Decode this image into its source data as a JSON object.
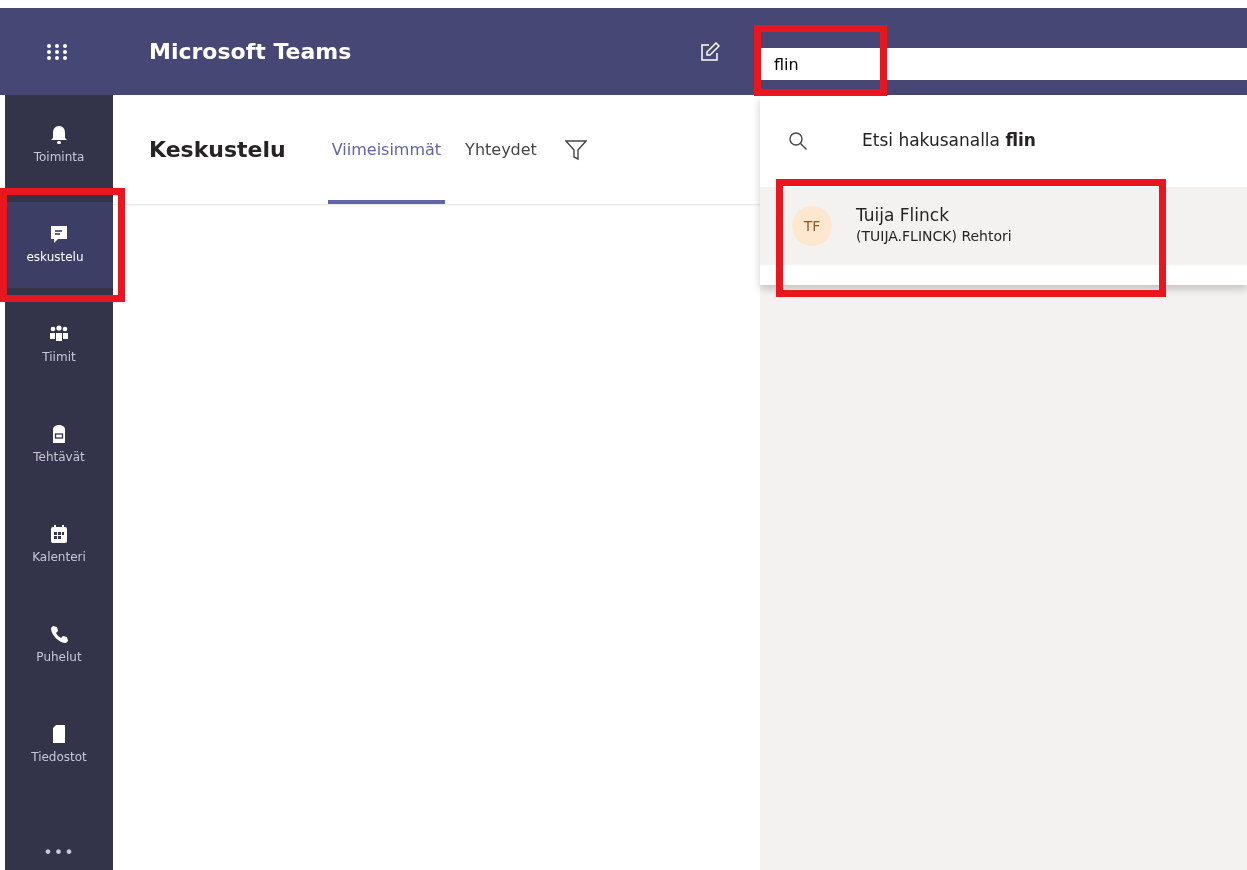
{
  "app": {
    "title": "Microsoft Teams"
  },
  "search": {
    "value": "flin",
    "highlighted": true
  },
  "rail": [
    {
      "label": "Toiminta",
      "kind": "bell",
      "selected": false,
      "highlighted": false
    },
    {
      "label": "eskustelu",
      "kind": "chat",
      "selected": true,
      "highlighted": true
    },
    {
      "label": "Tiimit",
      "kind": "teams",
      "selected": false,
      "highlighted": false
    },
    {
      "label": "Tehtävät",
      "kind": "bag",
      "selected": false,
      "highlighted": false
    },
    {
      "label": "Kalenteri",
      "kind": "calendar",
      "selected": false,
      "highlighted": false
    },
    {
      "label": "Puhelut",
      "kind": "phone",
      "selected": false,
      "highlighted": false
    },
    {
      "label": "Tiedostot",
      "kind": "file",
      "selected": false,
      "highlighted": false
    }
  ],
  "more": "•••",
  "chat": {
    "title": "Keskustelu",
    "tabs": [
      {
        "label": "Viimeisimmät",
        "selected": true
      },
      {
        "label": "Yhteydet",
        "selected": false
      }
    ]
  },
  "dropdown": {
    "search_row": "Etsi hakusanalla **flin**",
    "results": [
      {
        "initials": "TF",
        "name": "Tuija Flinck",
        "detail": "(TUIJA.FLINCK) Rehtori",
        "color": "#fde7cf",
        "highlighted": true
      }
    ]
  }
}
